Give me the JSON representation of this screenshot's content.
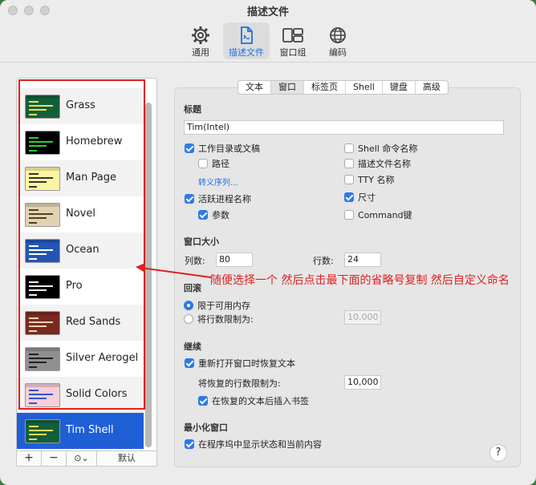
{
  "window": {
    "title": "描述文件"
  },
  "toolbar": [
    {
      "label": "通用",
      "icon": "gear-icon"
    },
    {
      "label": "描述文件",
      "icon": "document-icon"
    },
    {
      "label": "窗口组",
      "icon": "window-group-icon"
    },
    {
      "label": "编码",
      "icon": "globe-icon"
    }
  ],
  "profiles": [
    {
      "name": "Grass",
      "bg": "#12603a",
      "fg": "#f5d95a"
    },
    {
      "name": "Homebrew",
      "bg": "#000000",
      "fg": "#28d23a"
    },
    {
      "name": "Man Page",
      "bg": "#fdf4a2",
      "fg": "#333333"
    },
    {
      "name": "Novel",
      "bg": "#dfd3b2",
      "fg": "#5b3b24"
    },
    {
      "name": "Ocean",
      "bg": "#2356b4",
      "fg": "#ffffff"
    },
    {
      "name": "Pro",
      "bg": "#000000",
      "fg": "#eeeeee"
    },
    {
      "name": "Red Sands",
      "bg": "#7a2a20",
      "fg": "#e8d6b0"
    },
    {
      "name": "Silver Aerogel",
      "bg": "#8f8f8f",
      "fg": "#222222"
    },
    {
      "name": "Solid Colors",
      "bg": "#f5cfd9",
      "fg": "#3355cc"
    },
    {
      "name": "Tim Shell",
      "bg": "#12603a",
      "fg": "#f5d95a"
    }
  ],
  "list_buttons": {
    "add": "+",
    "remove": "−",
    "more": "⊙⌄",
    "default": "默认"
  },
  "tabs": [
    "文本",
    "窗口",
    "标签页",
    "Shell",
    "键盘",
    "高级"
  ],
  "title_section": {
    "heading": "标题",
    "value": "Tim(Intel)",
    "options": {
      "working_dir": "工作目录或文稿",
      "path": "路径",
      "escape_link": "转义序列…",
      "active_process": "活跃进程名称",
      "arguments": "参数",
      "shell_cmd": "Shell 命令名称",
      "profile_name": "描述文件名称",
      "tty": "TTY 名称",
      "size": "尺寸",
      "command_key": "Command键"
    }
  },
  "window_size": {
    "heading": "窗口大小",
    "columns_label": "列数:",
    "columns": "80",
    "rows_label": "行数:",
    "rows": "24"
  },
  "scrollback": {
    "heading": "回滚",
    "limit_memory": "限于可用内存",
    "limit_rows": "将行数限制为:",
    "rows_value": "10,000"
  },
  "restore": {
    "heading": "继续",
    "restore_text": "重新打开窗口时恢复文本",
    "limit_label": "将恢复的行数限制为:",
    "limit_value": "10,000",
    "insert_bookmark": "在恢复的文本后插入书签"
  },
  "minimize": {
    "heading": "最小化窗口",
    "show_status": "在程序坞中显示状态和当前内容"
  },
  "help": "?",
  "annotation": "随便选择一个 然后点击最下面的省略号复制 然后自定义命名",
  "colors": {
    "accent": "#1f5fd6",
    "annotation": "#e02020",
    "checkbox": "#2a7ae8"
  }
}
